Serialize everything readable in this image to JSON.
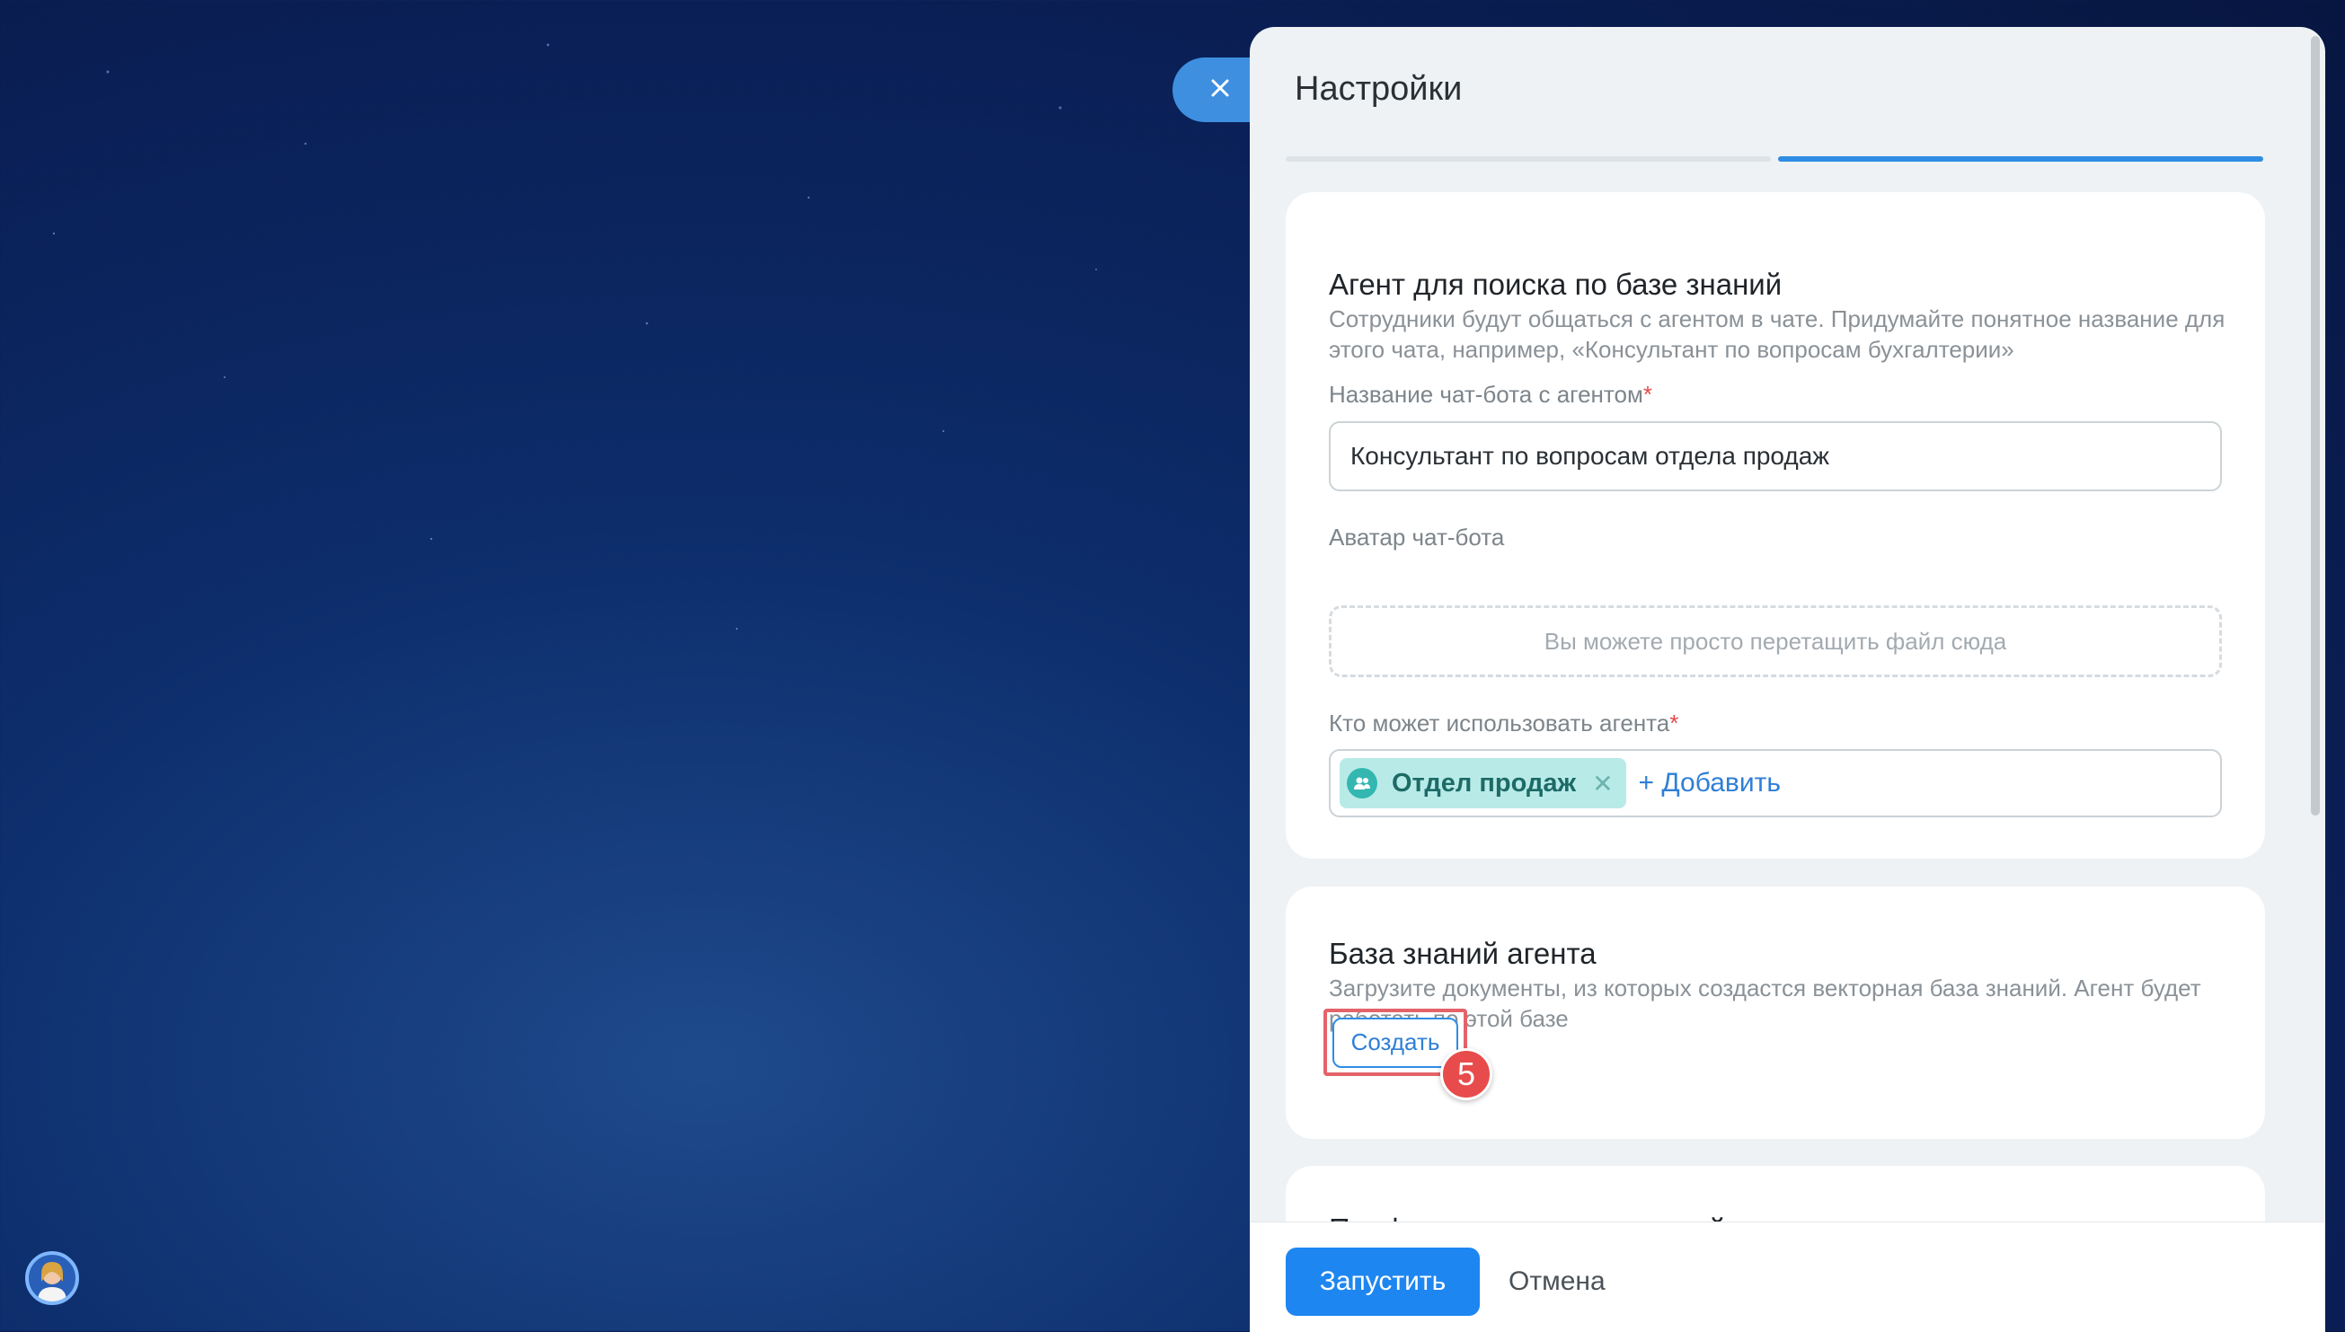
{
  "panel": {
    "title": "Настройки",
    "close_icon": "close-icon"
  },
  "agent_card": {
    "title": "Агент для поиска по базе знаний",
    "description": "Сотрудники будут общаться с агентом в чате. Придумайте понятное название для этого чата, например, «Консультант по вопросам бухгалтерии»",
    "name_label": "Название чат-бота с агентом",
    "name_value": "Консультант по вопросам отдела продаж",
    "avatar_label": "Аватар чат-бота",
    "dropzone_text": "Вы можете просто перетащить файл сюда",
    "access_label": "Кто может использовать агента",
    "required_mark": "*",
    "access_tag": "Отдел продаж",
    "add_link": "+ Добавить"
  },
  "knowledge_card": {
    "title": "База знаний агента",
    "description": "Загрузите документы, из которых создастся векторная база знаний. Агент будет работать по этой базе",
    "create_button": "Создать",
    "step_number": "5"
  },
  "pro_card": {
    "title": "Профессиональные настройки"
  },
  "footer": {
    "launch_button": "Запустить",
    "cancel_button": "Отмена"
  },
  "colors": {
    "accent": "#1e86f0",
    "highlight": "#e4636a",
    "tag_bg": "#b8ebe8"
  }
}
